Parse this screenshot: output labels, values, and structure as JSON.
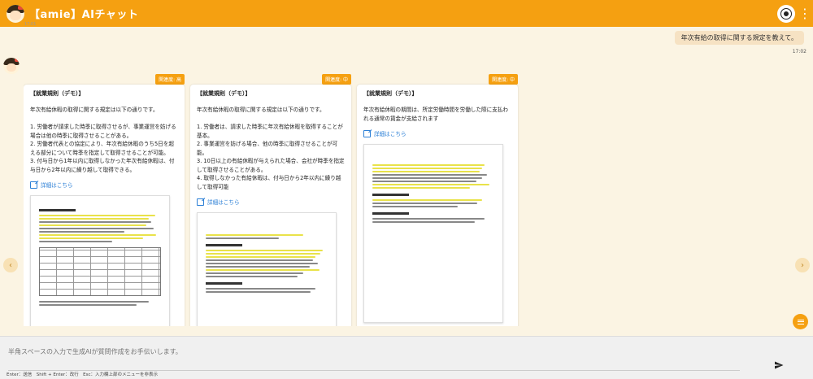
{
  "header": {
    "title": "【amie】AIチャット",
    "logo_icon": "mascot-icon",
    "user_icon": "user-avatar-icon",
    "menu_icon": "kebab-menu-icon"
  },
  "conversation": {
    "top_time": "17:01",
    "user_message": "年次有給の取得に関する規定を教えて。",
    "user_time": "17:02"
  },
  "cards": [
    {
      "badge": "関連度: 高",
      "title": "【就業規則（デモ）】",
      "text": "年次有給休暇の取得に関する規定は以下の通りです。\n\n1. 労働者が請求した時季に取得させるが、事業運営を妨げる場合は他の時季に取得させることがある。\n2. 労働者代表との協定により、年次有給休暇のうち5日を超える部分について時季を指定して取得させることが可能。\n3. 付与日から1年以内に取得しなかった年次有給休暇は、付与日から2年以内に繰り越して取得できる。",
      "link": "詳細はこちら"
    },
    {
      "badge": "関連度: 中",
      "title": "【就業規則（デモ）】",
      "text": "年次有給休暇の取得に関する規定は以下の通りです。\n\n1. 労働者は、請求した時季に年次有給休暇を取得することが基本。\n2. 事業運営を妨げる場合、他の時季に取得させることが可能。\n3. 10日以上の有給休暇が与えられた場合、会社が時季を指定して取得させることがある。\n4. 取得しなかった有給休暇は、付与日から2年以内に繰り越して取得可能",
      "link": "詳細はこちら"
    },
    {
      "badge": "関連度: 中",
      "title": "【就業規則（デモ）】",
      "text": "年次有給休暇の期間は、所定労働時間を労働した際に支払われる通常の賃金が支給されます",
      "link": "詳細はこちら"
    }
  ],
  "input": {
    "placeholder": "半角スペースの入力で生成AIが質問作成をお手伝いします。"
  },
  "hint": "Enter：送信　Shift + Enter：改行　Esc：入力欄上部のメニューを非表示",
  "colors": {
    "accent": "#f5a011",
    "background": "#fbf4e3",
    "link": "#2b7fd6"
  }
}
